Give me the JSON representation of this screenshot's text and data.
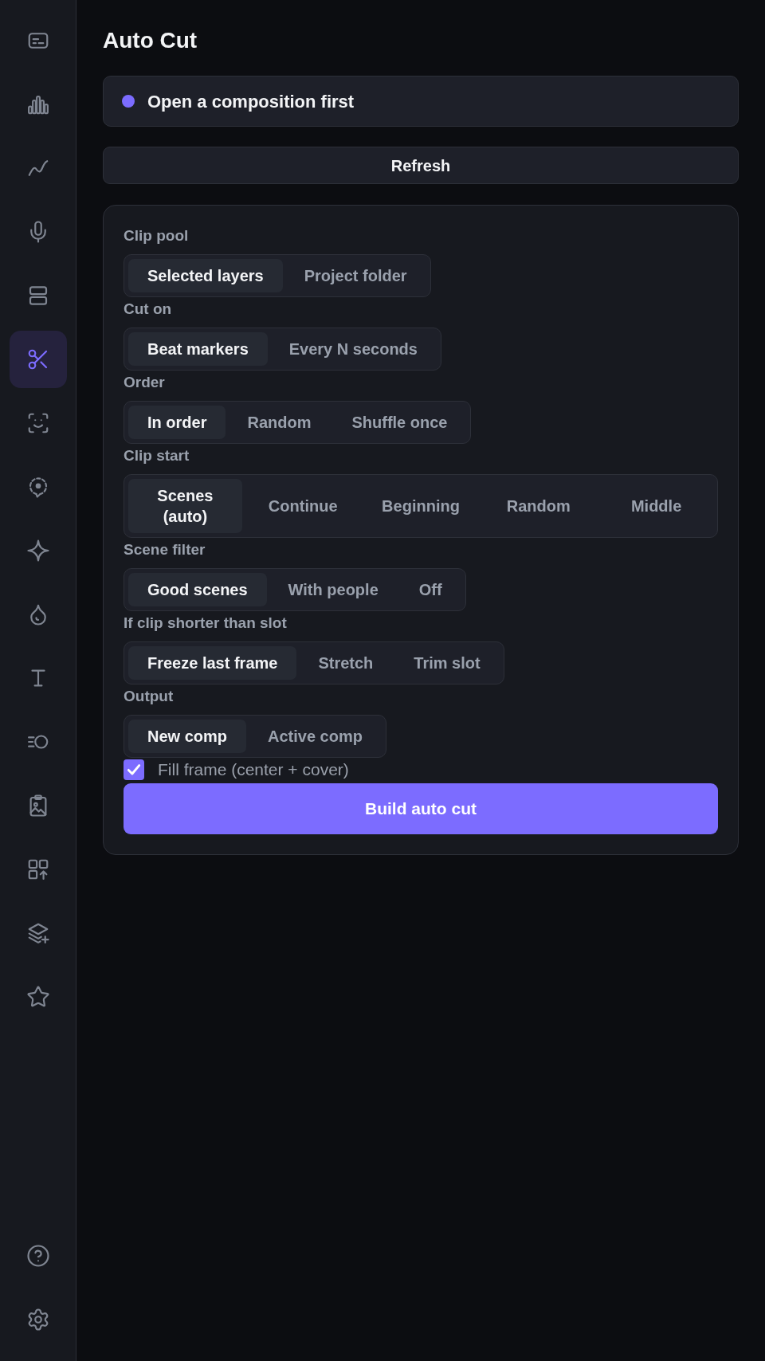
{
  "sidebar": {
    "items": [
      {
        "selected": false
      },
      {
        "selected": false
      },
      {
        "selected": false
      },
      {
        "selected": false
      },
      {
        "selected": false
      },
      {
        "selected": true
      },
      {
        "selected": false
      },
      {
        "selected": false
      },
      {
        "selected": false
      },
      {
        "selected": false
      },
      {
        "selected": false
      },
      {
        "selected": false
      },
      {
        "selected": false
      },
      {
        "selected": false
      },
      {
        "selected": false
      },
      {
        "selected": false
      }
    ]
  },
  "title": "Auto Cut",
  "status": {
    "message": "Open a composition first"
  },
  "refresh_button": "Refresh",
  "settings": [
    {
      "label": "Clip pool",
      "options": [
        {
          "label": "Selected layers",
          "selected": true
        },
        {
          "label": "Project folder",
          "selected": false
        }
      ]
    },
    {
      "label": "Cut on",
      "options": [
        {
          "label": "Beat markers",
          "selected": true
        },
        {
          "label": "Every N seconds",
          "selected": false
        }
      ]
    },
    {
      "label": "Order",
      "options": [
        {
          "label": "In order",
          "selected": true
        },
        {
          "label": "Random",
          "selected": false
        },
        {
          "label": "Shuffle once",
          "selected": false
        }
      ]
    },
    {
      "label": "Clip start",
      "options": [
        {
          "label": "Scenes (auto)",
          "selected": true
        },
        {
          "label": "Continue",
          "selected": false
        },
        {
          "label": "Beginning",
          "selected": false
        },
        {
          "label": "Random",
          "selected": false
        },
        {
          "label": "Middle",
          "selected": false
        }
      ]
    },
    {
      "label": "Scene filter",
      "options": [
        {
          "label": "Good scenes",
          "selected": true
        },
        {
          "label": "With people",
          "selected": false
        },
        {
          "label": "Off",
          "selected": false
        }
      ]
    },
    {
      "label": "If clip shorter than slot",
      "options": [
        {
          "label": "Freeze last frame",
          "selected": true
        },
        {
          "label": "Stretch",
          "selected": false
        },
        {
          "label": "Trim slot",
          "selected": false
        }
      ]
    },
    {
      "label": "Output",
      "options": [
        {
          "label": "New comp",
          "selected": true
        },
        {
          "label": "Active comp",
          "selected": false
        }
      ]
    }
  ],
  "fill_frame": {
    "label": "Fill frame (center + cover)",
    "checked": true
  },
  "build_button": "Build auto cut"
}
